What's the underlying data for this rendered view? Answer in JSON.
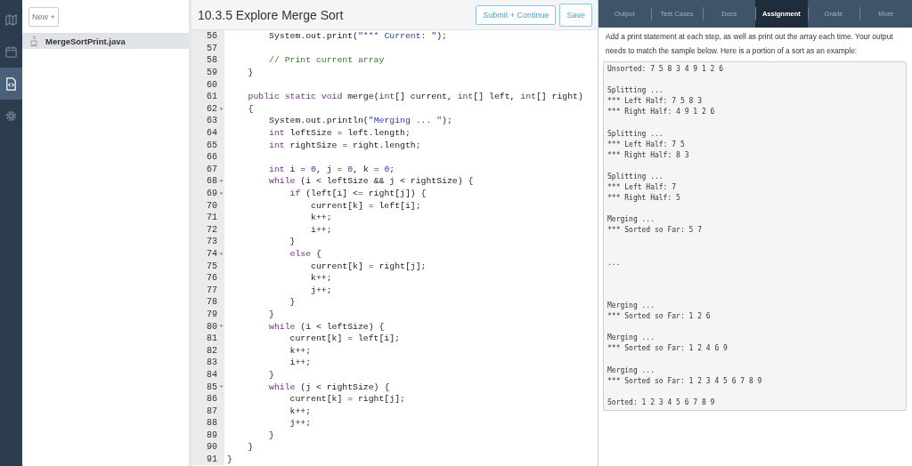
{
  "rail": [
    {
      "kind": "map",
      "selected": false
    },
    {
      "kind": "calendar",
      "selected": false
    },
    {
      "kind": "code",
      "selected": true
    },
    {
      "kind": "settings",
      "selected": false
    }
  ],
  "files": {
    "new_button": "New +",
    "items": [
      {
        "name": "MergeSortPrint.java",
        "selected": true
      }
    ]
  },
  "editor": {
    "title": "10.3.5 Explore Merge Sort",
    "buttons": [
      "Submit + Continue",
      "Save"
    ],
    "lines": [
      {
        "number": "56",
        "fold": false,
        "tokens": [
          {
            "text": "        System.out.print(",
            "kind": "plain"
          },
          {
            "text": "\"*** Current: \"",
            "kind": "str"
          },
          {
            "text": ");",
            "kind": "plain"
          }
        ]
      },
      {
        "number": "57",
        "fold": false
      },
      {
        "number": "58",
        "fold": false,
        "tokens": [
          {
            "text": "        // Print current array",
            "kind": "com"
          }
        ]
      },
      {
        "number": "59",
        "fold": false,
        "tokens": [
          {
            "text": "    }",
            "kind": "plain"
          }
        ]
      },
      {
        "number": "60",
        "fold": false
      },
      {
        "number": "61",
        "fold": false,
        "tokens": [
          {
            "text": "    public static void ",
            "kind": "kw"
          },
          {
            "text": "merge(",
            "kind": "plain"
          },
          {
            "text": "int",
            "kind": "kw"
          },
          {
            "text": "[] current, ",
            "kind": "plain"
          },
          {
            "text": "int",
            "kind": "kw"
          },
          {
            "text": "[] left, ",
            "kind": "plain"
          },
          {
            "text": "int",
            "kind": "kw"
          },
          {
            "text": "[] right)",
            "kind": "plain"
          }
        ]
      },
      {
        "number": "62",
        "fold": true,
        "tokens": [
          {
            "text": "    {",
            "kind": "plain"
          }
        ]
      },
      {
        "number": "63",
        "fold": false,
        "tokens": [
          {
            "text": "        System.out.println(",
            "kind": "plain"
          },
          {
            "text": "\"Merging ... \"",
            "kind": "str"
          },
          {
            "text": ");",
            "kind": "plain"
          }
        ]
      },
      {
        "number": "64",
        "fold": false,
        "tokens": [
          {
            "text": "        int",
            "kind": "kw"
          },
          {
            "text": " leftSize = left.length;",
            "kind": "plain"
          }
        ]
      },
      {
        "number": "65",
        "fold": false,
        "tokens": [
          {
            "text": "        int",
            "kind": "kw"
          },
          {
            "text": " rightSize = right.length;",
            "kind": "plain"
          }
        ]
      },
      {
        "number": "66",
        "fold": false
      },
      {
        "number": "67",
        "fold": false,
        "tokens": [
          {
            "text": "        int",
            "kind": "kw"
          },
          {
            "text": " i = ",
            "kind": "plain"
          },
          {
            "text": "0",
            "kind": "num"
          },
          {
            "text": ", j = ",
            "kind": "plain"
          },
          {
            "text": "0",
            "kind": "num"
          },
          {
            "text": ", k = ",
            "kind": "plain"
          },
          {
            "text": "0",
            "kind": "num"
          },
          {
            "text": ";",
            "kind": "plain"
          }
        ]
      },
      {
        "number": "68",
        "fold": true,
        "tokens": [
          {
            "text": "        while",
            "kind": "kw"
          },
          {
            "text": " (i < leftSize && j < rightSize) {",
            "kind": "plain"
          }
        ]
      },
      {
        "number": "69",
        "fold": true,
        "tokens": [
          {
            "text": "            if",
            "kind": "kw"
          },
          {
            "text": " (left[i] <= right[j]) {",
            "kind": "plain"
          }
        ]
      },
      {
        "number": "70",
        "fold": false,
        "tokens": [
          {
            "text": "                current[k] = left[i];",
            "kind": "plain"
          }
        ]
      },
      {
        "number": "71",
        "fold": false,
        "tokens": [
          {
            "text": "                k++;",
            "kind": "plain"
          }
        ]
      },
      {
        "number": "72",
        "fold": false,
        "tokens": [
          {
            "text": "                i++;",
            "kind": "plain"
          }
        ]
      },
      {
        "number": "73",
        "fold": false,
        "tokens": [
          {
            "text": "            }",
            "kind": "plain"
          }
        ]
      },
      {
        "number": "74",
        "fold": true,
        "tokens": [
          {
            "text": "            else",
            "kind": "kw"
          },
          {
            "text": " {",
            "kind": "plain"
          }
        ]
      },
      {
        "number": "75",
        "fold": false,
        "tokens": [
          {
            "text": "                current[k] = right[j];",
            "kind": "plain"
          }
        ]
      },
      {
        "number": "76",
        "fold": false,
        "tokens": [
          {
            "text": "                k++;",
            "kind": "plain"
          }
        ]
      },
      {
        "number": "77",
        "fold": false,
        "tokens": [
          {
            "text": "                j++;",
            "kind": "plain"
          }
        ]
      },
      {
        "number": "78",
        "fold": false,
        "tokens": [
          {
            "text": "            }",
            "kind": "plain"
          }
        ]
      },
      {
        "number": "79",
        "fold": false,
        "tokens": [
          {
            "text": "        }",
            "kind": "plain"
          }
        ]
      },
      {
        "number": "80",
        "fold": true,
        "tokens": [
          {
            "text": "        while",
            "kind": "kw"
          },
          {
            "text": " (i < leftSize) {",
            "kind": "plain"
          }
        ]
      },
      {
        "number": "81",
        "fold": false,
        "tokens": [
          {
            "text": "            current[k] = left[i];",
            "kind": "plain"
          }
        ]
      },
      {
        "number": "82",
        "fold": false,
        "tokens": [
          {
            "text": "            k++;",
            "kind": "plain"
          }
        ]
      },
      {
        "number": "83",
        "fold": false,
        "tokens": [
          {
            "text": "            i++;",
            "kind": "plain"
          }
        ]
      },
      {
        "number": "84",
        "fold": false,
        "tokens": [
          {
            "text": "        }",
            "kind": "plain"
          }
        ]
      },
      {
        "number": "85",
        "fold": true,
        "tokens": [
          {
            "text": "        while",
            "kind": "kw"
          },
          {
            "text": " (j < rightSize) {",
            "kind": "plain"
          }
        ]
      },
      {
        "number": "86",
        "fold": false,
        "tokens": [
          {
            "text": "            current[k] = right[j];",
            "kind": "plain"
          }
        ]
      },
      {
        "number": "87",
        "fold": false,
        "tokens": [
          {
            "text": "            k++;",
            "kind": "plain"
          }
        ]
      },
      {
        "number": "88",
        "fold": false,
        "tokens": [
          {
            "text": "            j++;",
            "kind": "plain"
          }
        ]
      },
      {
        "number": "89",
        "fold": false,
        "tokens": [
          {
            "text": "        }",
            "kind": "plain"
          }
        ]
      },
      {
        "number": "90",
        "fold": false,
        "tokens": [
          {
            "text": "    }",
            "kind": "plain"
          }
        ]
      },
      {
        "number": "91",
        "fold": false,
        "tokens": [
          {
            "text": "}",
            "kind": "plain"
          }
        ]
      }
    ]
  },
  "panel": {
    "tabs": [
      {
        "label": "Output",
        "selected": false
      },
      {
        "label": "Test Cases",
        "selected": false
      },
      {
        "label": "Docs",
        "selected": false
      },
      {
        "label": "Assignment",
        "selected": true
      },
      {
        "label": "Grade",
        "selected": false
      },
      {
        "label": "More",
        "selected": false
      }
    ],
    "instructions": "Add a print statement at each step, as well as print out the array each time. Your output needs to match the sample below. Here is a portion of a sort as an example:",
    "sample_output": "Unsorted: 7 5 8 3 4 9 1 2 6\n\nSplitting ...\n*** Left Half: 7 5 8 3\n*** Right Half: 4 9 1 2 6\n\nSplitting ...\n*** Left Half: 7 5\n*** Right Half: 8 3\n\nSplitting ...\n*** Left Half: 7\n*** Right Half: 5\n\nMerging ...\n*** Sorted so Far: 5 7\n\n\n...\n\n\n\nMerging ...\n*** Sorted so Far: 1 2 6\n\nMerging ...\n*** Sorted so Far: 1 2 4 6 9\n\nMerging ...\n*** Sorted so Far: 1 2 3 4 5 6 7 8 9\n\nSorted: 1 2 3 4 5 6 7 8 9"
  }
}
